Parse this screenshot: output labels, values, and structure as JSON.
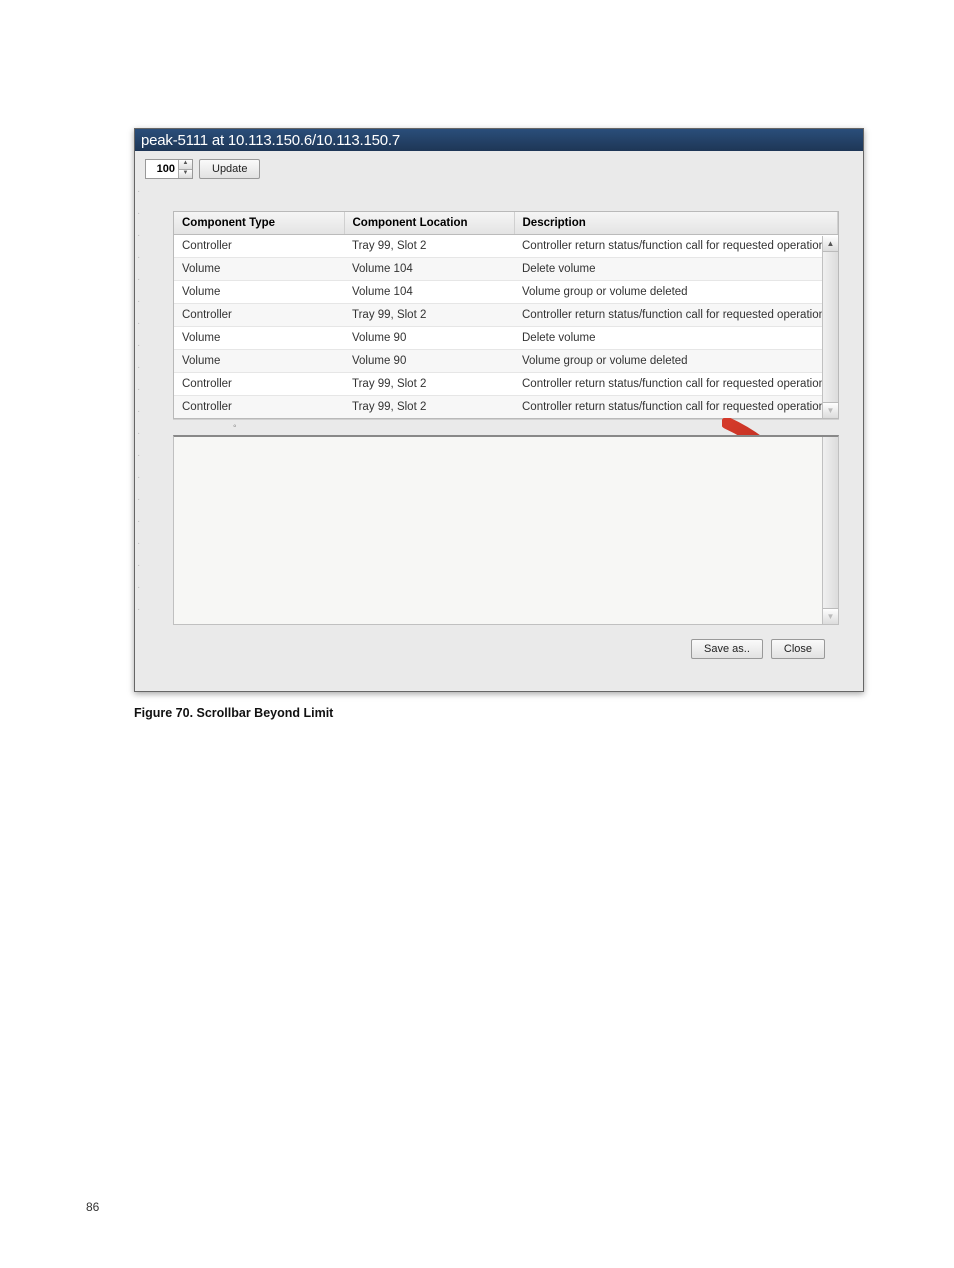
{
  "titlebar": "peak-5111 at 10.113.150.6/10.113.150.7",
  "toolbar": {
    "spinner_value": "100",
    "update_label": "Update"
  },
  "columns": {
    "type": "Component Type",
    "location": "Component Location",
    "desc": "Description"
  },
  "rows": [
    {
      "type": "Controller",
      "location": "Tray 99, Slot 2",
      "desc": "Controller return status/function call for requested operation"
    },
    {
      "type": "Volume",
      "location": "Volume 104",
      "desc": "Delete volume"
    },
    {
      "type": "Volume",
      "location": "Volume 104",
      "desc": "Volume group or volume deleted"
    },
    {
      "type": "Controller",
      "location": "Tray 99, Slot 2",
      "desc": "Controller return status/function call for requested operation"
    },
    {
      "type": "Volume",
      "location": "Volume 90",
      "desc": "Delete volume"
    },
    {
      "type": "Volume",
      "location": "Volume 90",
      "desc": "Volume group or volume deleted"
    },
    {
      "type": "Controller",
      "location": "Tray 99, Slot 2",
      "desc": "Controller return status/function call for requested operation"
    },
    {
      "type": "Controller",
      "location": "Tray 99, Slot 2",
      "desc": "Controller return status/function call for requested operation"
    }
  ],
  "footer": {
    "save_label": "Save as..",
    "close_label": "Close"
  },
  "caption": "Figure 70. Scrollbar Beyond Limit",
  "page_number": "86"
}
